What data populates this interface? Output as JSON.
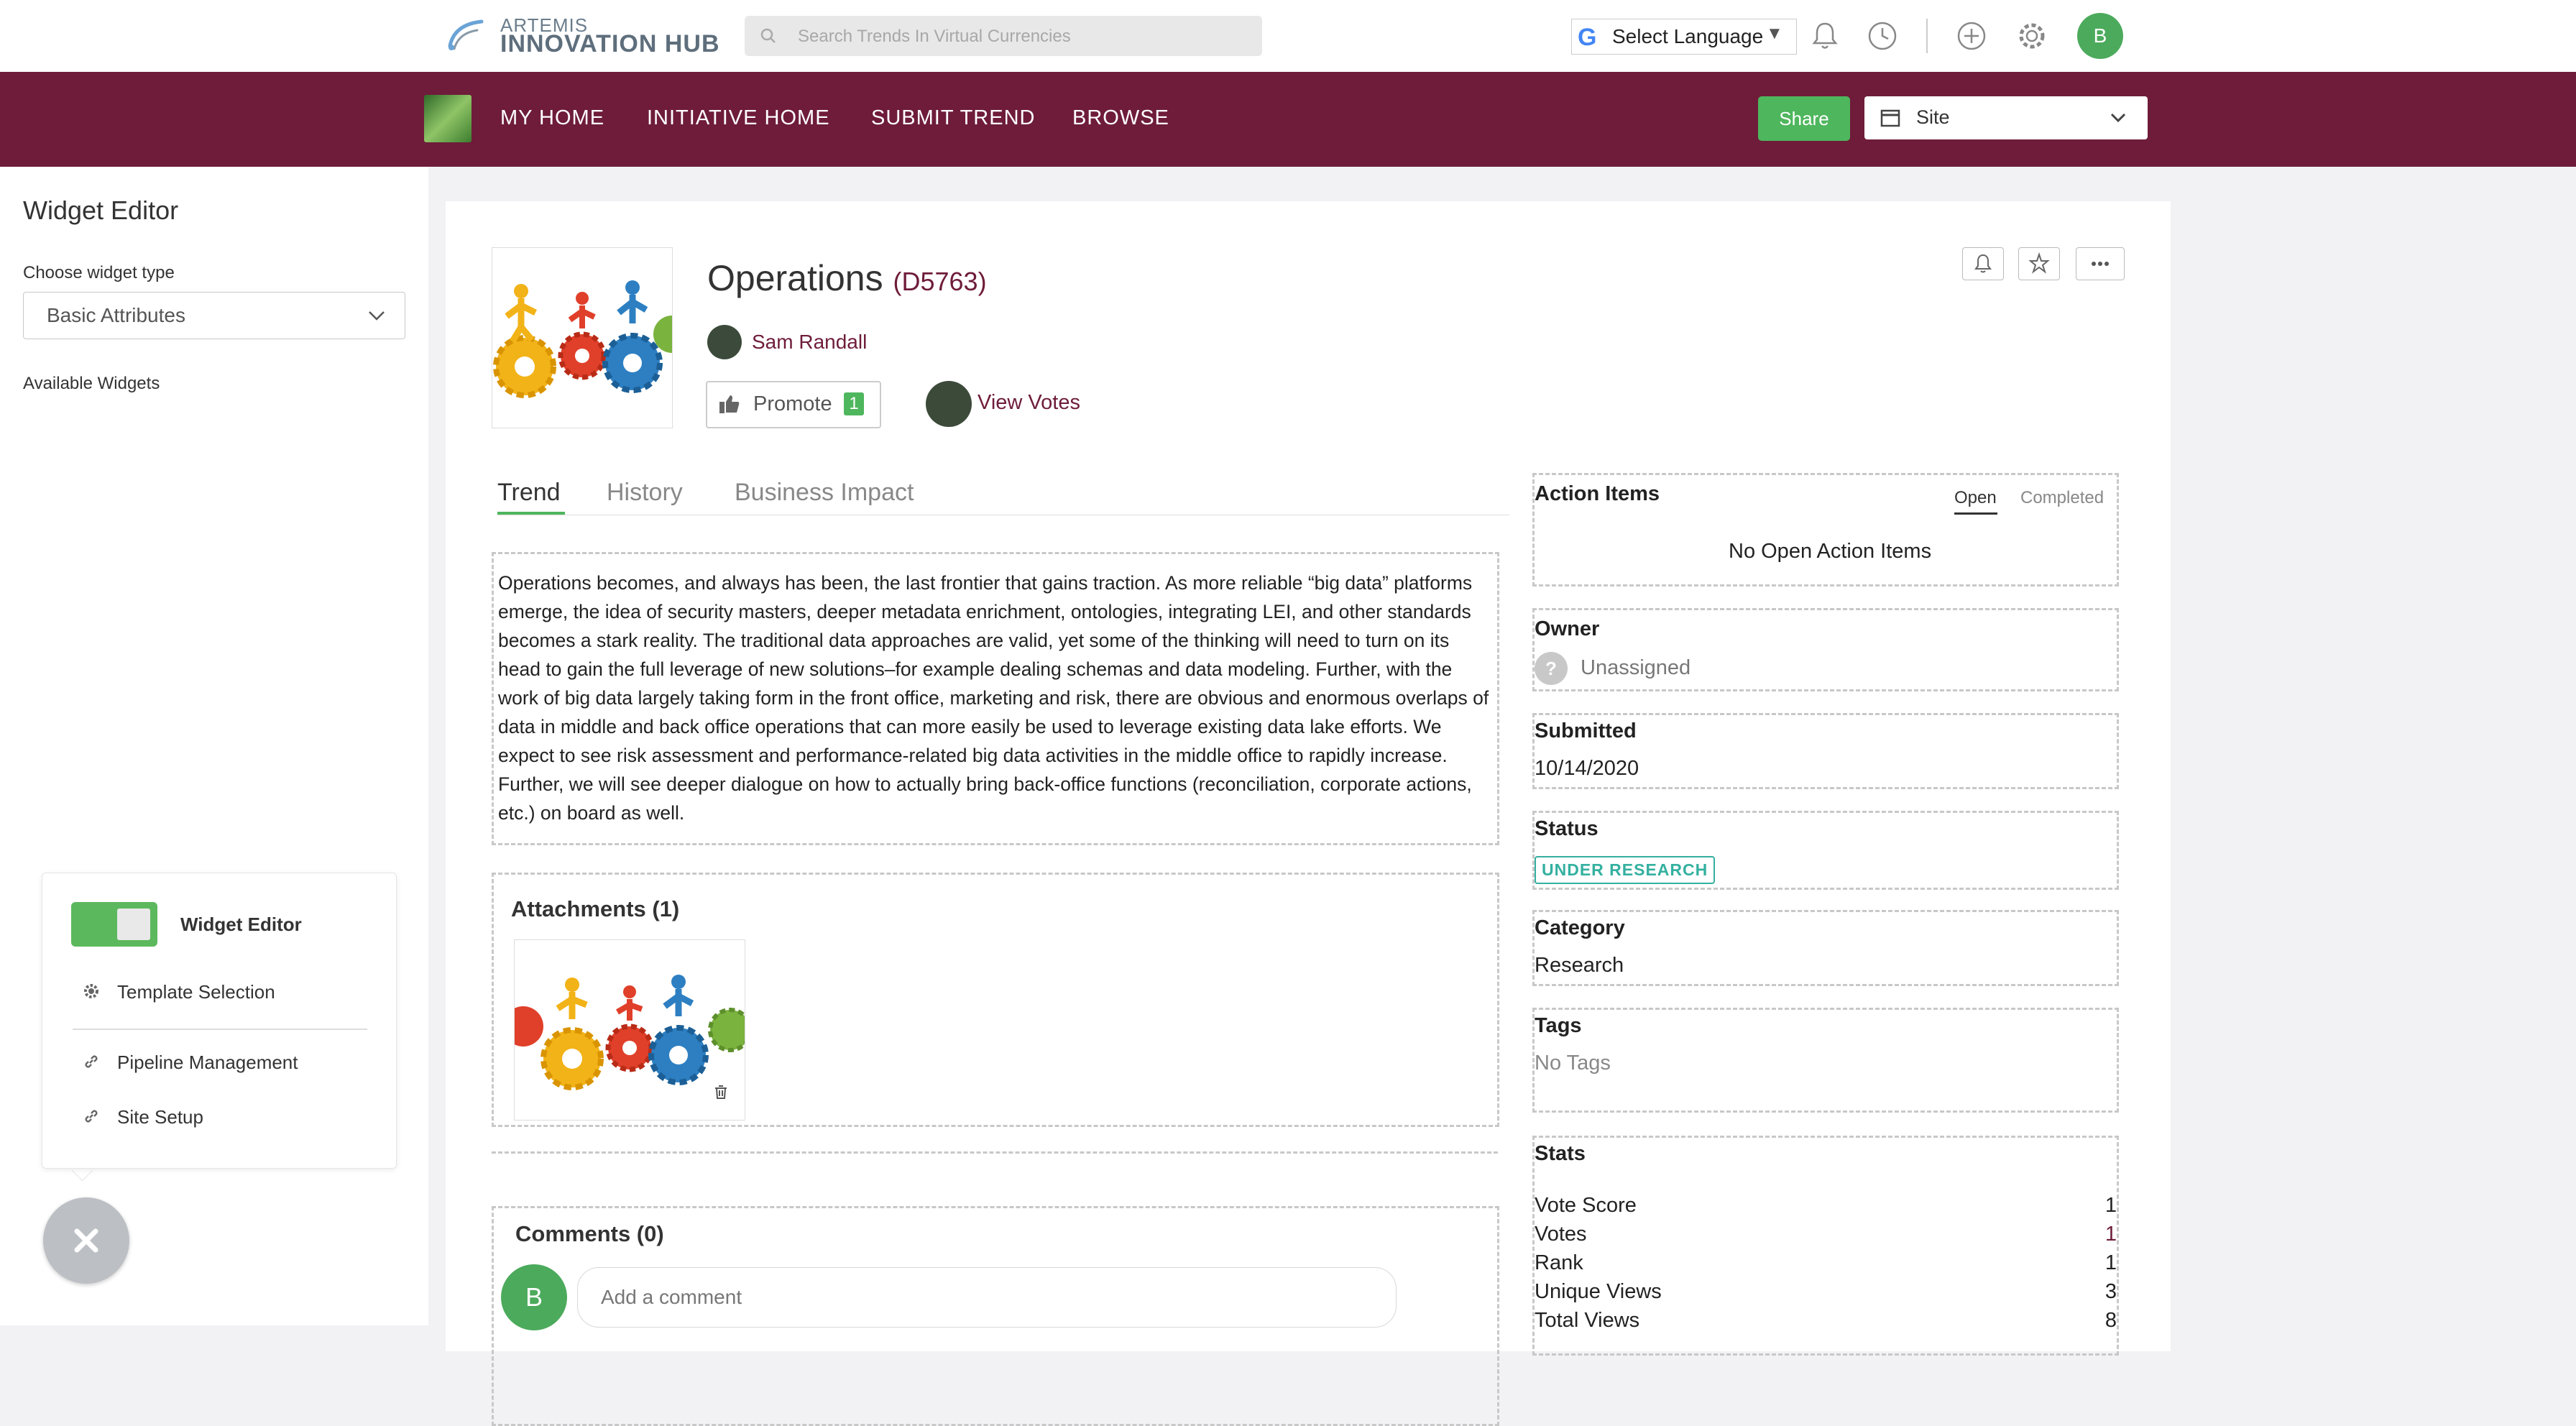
{
  "topbar": {
    "logo_line1": "ARTEMIS",
    "logo_line2": "INNOVATION HUB",
    "search_placeholder": "Search Trends In Virtual Currencies",
    "language_label": "Select Language",
    "avatar_initial": "B"
  },
  "nav": {
    "links": [
      "MY HOME",
      "INITIATIVE HOME",
      "SUBMIT TREND",
      "BROWSE"
    ],
    "share_label": "Share",
    "site_select_value": "Site"
  },
  "widget_panel": {
    "title": "Widget Editor",
    "choose_type_label": "Choose widget type",
    "choose_type_value": "Basic Attributes",
    "available_label": "Available Widgets"
  },
  "popup": {
    "toggle_label": "Widget Editor",
    "items": [
      "Template Selection",
      "Pipeline Management",
      "Site Setup"
    ]
  },
  "trend": {
    "title": "Operations",
    "id": "(D5763)",
    "author": "Sam Randall",
    "promote_label": "Promote",
    "promote_count": "1",
    "view_votes_label": "View Votes",
    "tabs": [
      "Trend",
      "History",
      "Business Impact"
    ],
    "description": "Operations becomes, and always has been, the last frontier that gains traction. As more reliable “big data” platforms emerge, the idea of security masters, deeper metadata enrichment, ontologies, integrating LEI, and other standards becomes a stark reality. The traditional data approaches are valid, yet some of the thinking will need to turn on its head to gain the full leverage of new solutions–for example dealing schemas and data modeling. Further, with the work of big data largely taking form in the front office, marketing and risk, there are obvious and enormous overlaps of data in middle and back office operations that can more easily be used to leverage existing data lake efforts. We expect to see risk assessment and performance-related big data activities in the middle office to rapidly increase. Further, we will see deeper dialogue on how to actually bring back-office functions (reconciliation, corporate actions, etc.) on board as well.",
    "attachments_title": "Attachments (1)",
    "comments_title": "Comments (0)",
    "comment_placeholder": "Add a comment",
    "comment_avatar": "B"
  },
  "sidebar": {
    "action_items": {
      "title": "Action Items",
      "tab_open": "Open",
      "tab_completed": "Completed",
      "empty_text": "No Open Action Items"
    },
    "owner": {
      "title": "Owner",
      "value": "Unassigned",
      "icon_text": "?"
    },
    "submitted": {
      "title": "Submitted",
      "value": "10/14/2020"
    },
    "status": {
      "title": "Status",
      "value": "UNDER RESEARCH"
    },
    "category": {
      "title": "Category",
      "value": "Research"
    },
    "tags": {
      "title": "Tags",
      "value": "No Tags"
    },
    "stats": {
      "title": "Stats",
      "rows": [
        {
          "label": "Vote Score",
          "value": "1"
        },
        {
          "label": "Votes",
          "value": "1"
        },
        {
          "label": "Rank",
          "value": "1"
        },
        {
          "label": "Unique Views",
          "value": "3"
        },
        {
          "label": "Total Views",
          "value": "8"
        }
      ]
    }
  },
  "colors": {
    "brand": "#6e1c3a",
    "accent_green": "#4eb65d",
    "status_teal": "#34b0a0"
  }
}
